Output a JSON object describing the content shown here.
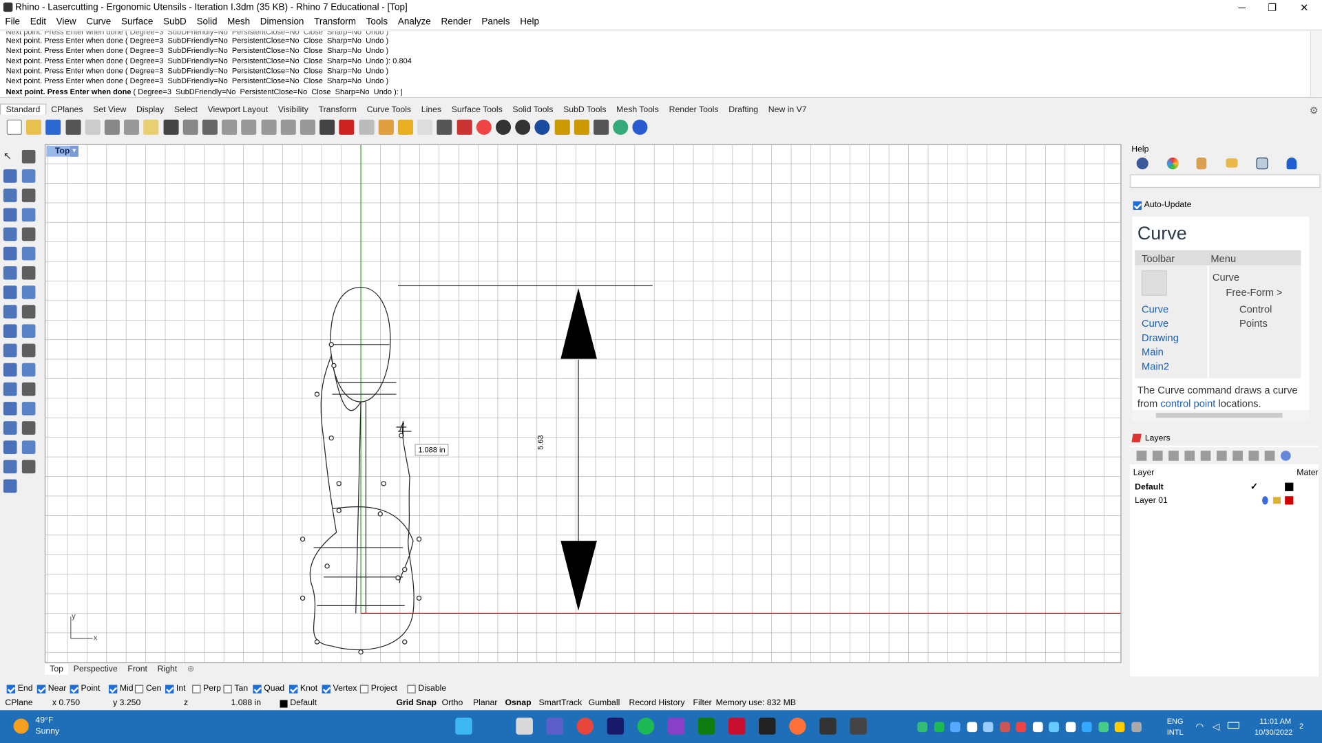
{
  "titlebar": {
    "title": "Rhino - Lasercutting - Ergonomic Utensils - Iteration I.3dm (35 KB) - Rhino 7 Educational - [Top]",
    "minimize": "─",
    "maximize": "❐",
    "close": "✕"
  },
  "menu": [
    "File",
    "Edit",
    "View",
    "Curve",
    "Surface",
    "SubD",
    "Solid",
    "Mesh",
    "Dimension",
    "Transform",
    "Tools",
    "Analyze",
    "Render",
    "Panels",
    "Help"
  ],
  "command_history": [
    "Next point. Press Enter when done ( Degree=3  SubDFriendly=No  PersistentClose=No  Close  Sharp=No  Undo )",
    "Next point. Press Enter when done ( Degree=3  SubDFriendly=No  PersistentClose=No  Close  Sharp=No  Undo )",
    "Next point. Press Enter when done ( Degree=3  SubDFriendly=No  PersistentClose=No  Close  Sharp=No  Undo ): 0.804",
    "Next point. Press Enter when done ( Degree=3  SubDFriendly=No  PersistentClose=No  Close  Sharp=No  Undo )",
    "Next point. Press Enter when done ( Degree=3  SubDFriendly=No  PersistentClose=No  Close  Sharp=No  Undo )"
  ],
  "command_prompt": {
    "text": "Next point. Press Enter when done",
    "options": "( Degree=3  SubDFriendly=No  PersistentClose=No  Close  Sharp=No  Undo ): |"
  },
  "toolbar_tabs": [
    "Standard",
    "CPlanes",
    "Set View",
    "Display",
    "Select",
    "Viewport Layout",
    "Visibility",
    "Transform",
    "Curve Tools",
    "Lines",
    "Surface Tools",
    "Solid Tools",
    "SubD Tools",
    "Mesh Tools",
    "Render Tools",
    "Drafting",
    "New in V7"
  ],
  "viewport": {
    "name": "Top",
    "tooltip": "1.088 in",
    "dimension_text": "5.63",
    "axis_y": "y",
    "axis_x": "x"
  },
  "view_tabs": [
    "Top",
    "Perspective",
    "Front",
    "Right"
  ],
  "view_tabs_add": "⊕",
  "osnaps": [
    {
      "label": "End",
      "on": true
    },
    {
      "label": "Near",
      "on": true
    },
    {
      "label": "Point",
      "on": true
    },
    {
      "label": "Mid",
      "on": true
    },
    {
      "label": "Cen",
      "on": false
    },
    {
      "label": "Int",
      "on": true
    },
    {
      "label": "Perp",
      "on": false
    },
    {
      "label": "Tan",
      "on": false
    },
    {
      "label": "Quad",
      "on": true
    },
    {
      "label": "Knot",
      "on": true
    },
    {
      "label": "Vertex",
      "on": true
    },
    {
      "label": "Project",
      "on": false
    },
    {
      "label": "Disable",
      "on": false
    }
  ],
  "status": {
    "cplane": "CPlane",
    "x": "x 0.750",
    "y": "y 3.250",
    "z": "z",
    "dist": "1.088 in",
    "layer": "Default",
    "toggles": [
      "Grid Snap",
      "Ortho",
      "Planar",
      "Osnap",
      "SmartTrack",
      "Gumball",
      "Record History",
      "Filter"
    ],
    "memory": "Memory use: 832 MB"
  },
  "help": {
    "title": "Help",
    "autoupdate": "Auto-Update",
    "heading": "Curve",
    "col_toolbar": "Toolbar",
    "col_menu": "Menu",
    "links": [
      "Curve",
      "Curve",
      "Drawing",
      "Main",
      "Main2"
    ],
    "menu_path": [
      "Curve",
      "Free-Form >",
      "Control",
      "Points"
    ],
    "desc_pre": "The Curve command draws a curve from ",
    "desc_link": "control point",
    "desc_post": " locations."
  },
  "layers": {
    "title": "Layers",
    "col_layer": "Layer",
    "col_mat": "Mater",
    "rows": [
      {
        "name": "Default",
        "color": "#000000",
        "current": true
      },
      {
        "name": "Layer 01",
        "color": "#cc0000",
        "current": false
      }
    ]
  },
  "taskbar": {
    "temp": "49°F",
    "weather": "Sunny",
    "lang1": "ENG",
    "lang2": "INTL",
    "time": "11:01 AM",
    "date": "10/30/2022",
    "notif": "2"
  }
}
